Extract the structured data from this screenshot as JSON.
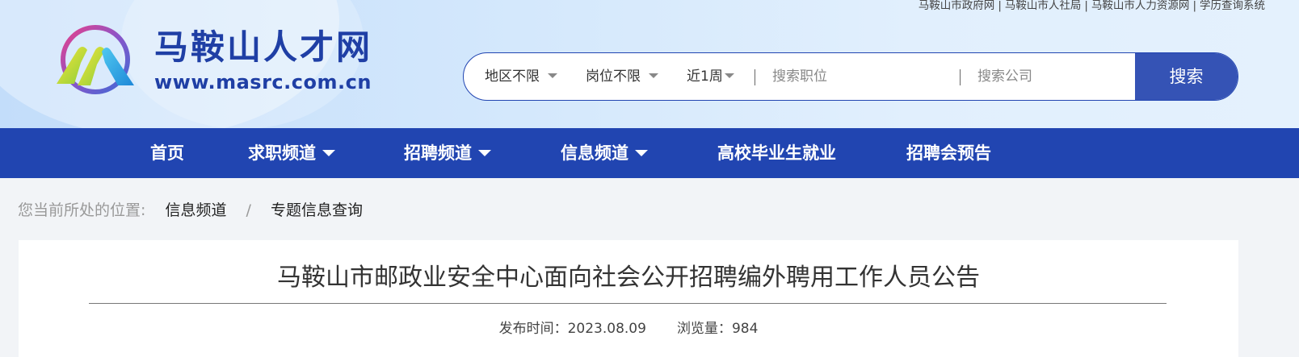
{
  "top_links": [
    "马鞍山市政府网",
    "马鞍山市人社局",
    "马鞍山市人力资源网",
    "学历查询系统"
  ],
  "top_link_separator": "|",
  "brand": {
    "name": "马鞍山人才网",
    "url": "www.masrc.com.cn",
    "logo_icon": "masrc-logo-icon"
  },
  "search": {
    "region": "地区不限",
    "position": "岗位不限",
    "time": "近1周",
    "job_placeholder": "搜索职位",
    "company_placeholder": "搜索公司",
    "button_label": "搜索"
  },
  "nav": {
    "items": [
      {
        "label": "首页",
        "dropdown": false
      },
      {
        "label": "求职频道",
        "dropdown": true
      },
      {
        "label": "招聘频道",
        "dropdown": true
      },
      {
        "label": "信息频道",
        "dropdown": true
      },
      {
        "label": "高校毕业生就业",
        "dropdown": false
      },
      {
        "label": "招聘会预告",
        "dropdown": false
      }
    ]
  },
  "breadcrumb": {
    "prefix": "您当前所处的位置:",
    "items": [
      "信息频道",
      "专题信息查询"
    ],
    "separator": "/"
  },
  "article": {
    "title": "马鞍山市邮政业安全中心面向社会公开招聘编外聘用工作人员公告",
    "publish_label": "发布时间：",
    "publish_date": "2023.08.09",
    "views_label": "浏览量：",
    "views": "984"
  },
  "colors": {
    "brand_blue": "#2145b1",
    "search_button": "#3553b5",
    "header_bg": "#d4e8fc",
    "page_bg": "#f2f4f7"
  }
}
